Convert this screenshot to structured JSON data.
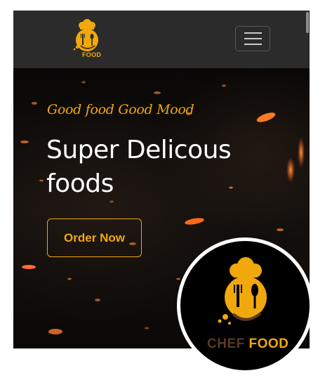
{
  "brand": {
    "word1": "CHEF",
    "word2": "FOOD",
    "small_word2": "FOOD",
    "logo_icon": "chef-hat-cutlery-icon",
    "primary_color": "#f1a80d",
    "dark_brown": "#5a3a1f"
  },
  "navbar": {
    "background": "#2b2b2b",
    "toggle_icon": "hamburger-menu-icon"
  },
  "hero": {
    "tagline": "Good food Good Mood",
    "heading": "Super Delicous foods",
    "cta_label": "Order Now"
  }
}
